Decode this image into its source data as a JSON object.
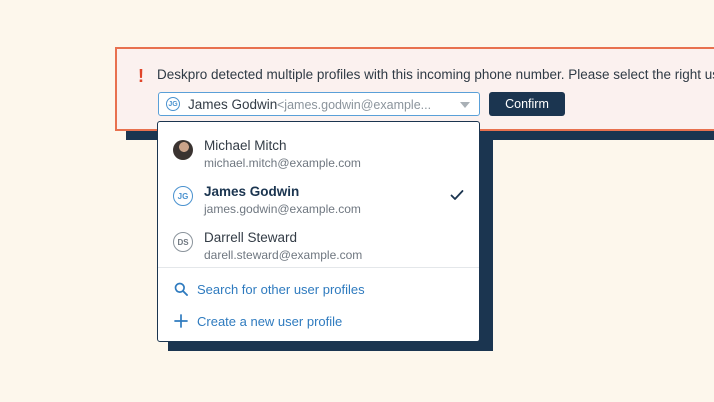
{
  "banner": {
    "alert_glyph": "!",
    "message": "Deskpro detected multiple profiles with this incoming phone number. Please select the right user",
    "confirm_label": "Confirm"
  },
  "select": {
    "initials": "JG",
    "selected_name": "James Godwin",
    "selected_email": "<james.godwin@example..."
  },
  "dropdown": {
    "profiles": [
      {
        "name": "Michael Mitch",
        "email": "michael.mitch@example.com",
        "avatar": "photo"
      },
      {
        "name": "James Godwin",
        "email": "james.godwin@example.com",
        "initials": "JG",
        "selected": true
      },
      {
        "name": "Darrell Steward",
        "email": "darell.steward@example.com",
        "initials": "DS"
      }
    ],
    "actions": [
      {
        "label": "Search for other user profiles",
        "icon": "search-icon"
      },
      {
        "label": "Create a new user profile",
        "icon": "plus-icon"
      }
    ]
  },
  "colors": {
    "navy": "#1b3550",
    "alert": "#e0452a",
    "border_alert": "#e8714f",
    "link": "#2f7bbf",
    "background": "#fdf7ec"
  }
}
